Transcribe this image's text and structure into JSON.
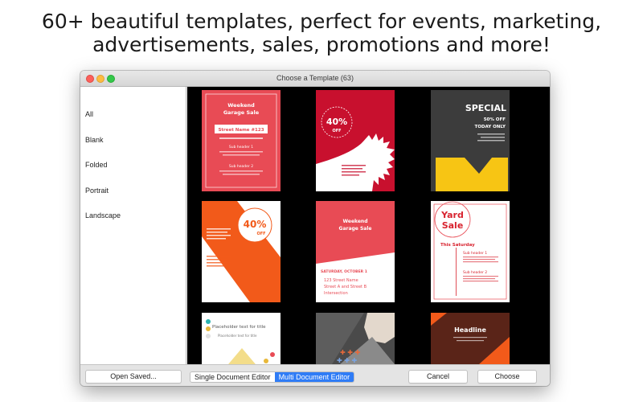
{
  "headline": {
    "line1": "60+ beautiful templates, perfect for events, marketing,",
    "line2": "advertisements, sales, promotions and more!"
  },
  "window": {
    "title": "Choose a Template (63)"
  },
  "sidebar": {
    "items": [
      {
        "label": "All"
      },
      {
        "label": "Blank"
      },
      {
        "label": "Folded"
      },
      {
        "label": "Portrait"
      },
      {
        "label": "Landscape"
      }
    ]
  },
  "templates": {
    "t1": {
      "title_line1": "Weekend",
      "title_line2": "Garage Sale",
      "street": "Street Name #123",
      "sub1": "Sub header 1",
      "sub2": "Sub header 2"
    },
    "t2": {
      "big": "40%",
      "small": "OFF"
    },
    "t3": {
      "title": "SPECIAL",
      "line1": "50% OFF",
      "line2": "TODAY ONLY"
    },
    "t4": {
      "big": "40%",
      "small": "OFF"
    },
    "t5": {
      "title_line1": "Weekend",
      "title_line2": "Garage Sale",
      "date": "SATURDAY, OCTOBER 1",
      "addr1": "123 Street Name",
      "addr2": "Street A and Street B",
      "addr3": "Intersection"
    },
    "t6": {
      "title_line1": "Yard",
      "title_line2": "Sale",
      "day": "This Saturday",
      "sub1": "Sub header 1",
      "sub2": "Sub header 2"
    },
    "t7": {
      "title": "Placeholder text for title",
      "subtitle": "Placeholder text for title"
    },
    "t9": {
      "title": "Headline"
    }
  },
  "buttons": {
    "open_saved": "Open Saved...",
    "single_editor": "Single Document Editor",
    "multi_editor": "Multi Document Editor",
    "cancel": "Cancel",
    "choose": "Choose"
  },
  "colors": {
    "accent": "#2f7cf6",
    "template_red": "#e84b55",
    "template_orange": "#f25a1a",
    "template_yellow": "#f7c514"
  }
}
